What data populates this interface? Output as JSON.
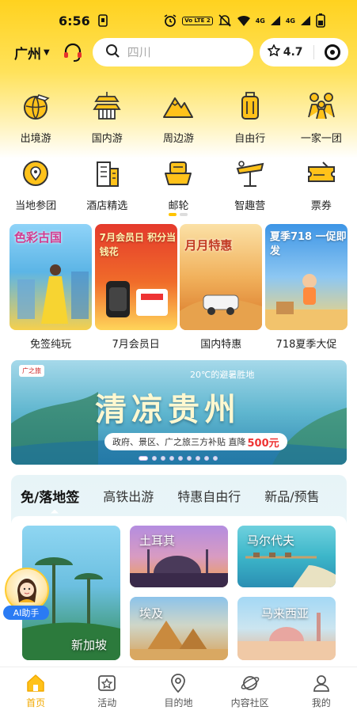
{
  "status_bar": {
    "time": "6:56",
    "volte": "Vo LTE 2",
    "signal1": "4G",
    "signal2": "4G"
  },
  "header": {
    "city": "广州",
    "search_placeholder": "四川",
    "rating": "4.7"
  },
  "categories": [
    {
      "label": "出境游",
      "icon": "globe-plane-icon"
    },
    {
      "label": "国内游",
      "icon": "temple-icon"
    },
    {
      "label": "周边游",
      "icon": "mountain-icon"
    },
    {
      "label": "自由行",
      "icon": "suitcase-icon"
    },
    {
      "label": "一家一团",
      "icon": "family-icon"
    },
    {
      "label": "当地参团",
      "icon": "local-tour-icon"
    },
    {
      "label": "酒店精选",
      "icon": "hotel-icon"
    },
    {
      "label": "邮轮",
      "icon": "cruise-icon"
    },
    {
      "label": "智趣营",
      "icon": "camp-icon"
    },
    {
      "label": "票券",
      "icon": "ticket-icon"
    }
  ],
  "promos": [
    {
      "label": "免签纯玩",
      "title": "色彩古国",
      "colors": [
        "#7ec4ef",
        "#f5d24c"
      ]
    },
    {
      "label": "7月会员日",
      "title": "7月会员日 积分当钱花",
      "colors": [
        "#e8392f",
        "#ffd34d"
      ]
    },
    {
      "label": "国内特惠",
      "title": "月月特惠",
      "colors": [
        "#f3b44a",
        "#d77524"
      ]
    },
    {
      "label": "718夏季大促",
      "title": "夏季718 一促即发",
      "colors": [
        "#2f8be0",
        "#ffcf5a"
      ]
    }
  ],
  "banner": {
    "brand": "广之旅",
    "temp_text": "20℃的避暑胜地",
    "title": "清凉贵州",
    "subtitle": "政府、景区、广之旅三方补贴 直降",
    "price": "500元"
  },
  "tabs": [
    {
      "label": "免/落地签",
      "active": true
    },
    {
      "label": "高铁出游",
      "active": false
    },
    {
      "label": "特惠自由行",
      "active": false
    },
    {
      "label": "新品/预售",
      "active": false
    }
  ],
  "destinations": [
    {
      "name": "新加坡",
      "colors": [
        "#7fd0f0",
        "#2f8a4f"
      ]
    },
    {
      "name": "土耳其",
      "colors": [
        "#b07bd6",
        "#f0a04a"
      ]
    },
    {
      "name": "马尔代夫",
      "colors": [
        "#5ec9d8",
        "#2b8fb3"
      ]
    },
    {
      "name": "埃及",
      "colors": [
        "#7fb9e3",
        "#d8a25a"
      ]
    },
    {
      "name": "马来西亚",
      "colors": [
        "#9ad0f2",
        "#e8b28a"
      ]
    }
  ],
  "ai_helper": {
    "label": "AI助手"
  },
  "bottom_nav": [
    {
      "label": "首页",
      "icon": "home-icon",
      "active": true
    },
    {
      "label": "活动",
      "icon": "activity-icon",
      "active": false
    },
    {
      "label": "目的地",
      "icon": "location-pin-icon",
      "active": false
    },
    {
      "label": "内容社区",
      "icon": "planet-icon",
      "active": false
    },
    {
      "label": "我的",
      "icon": "user-icon",
      "active": false
    }
  ]
}
